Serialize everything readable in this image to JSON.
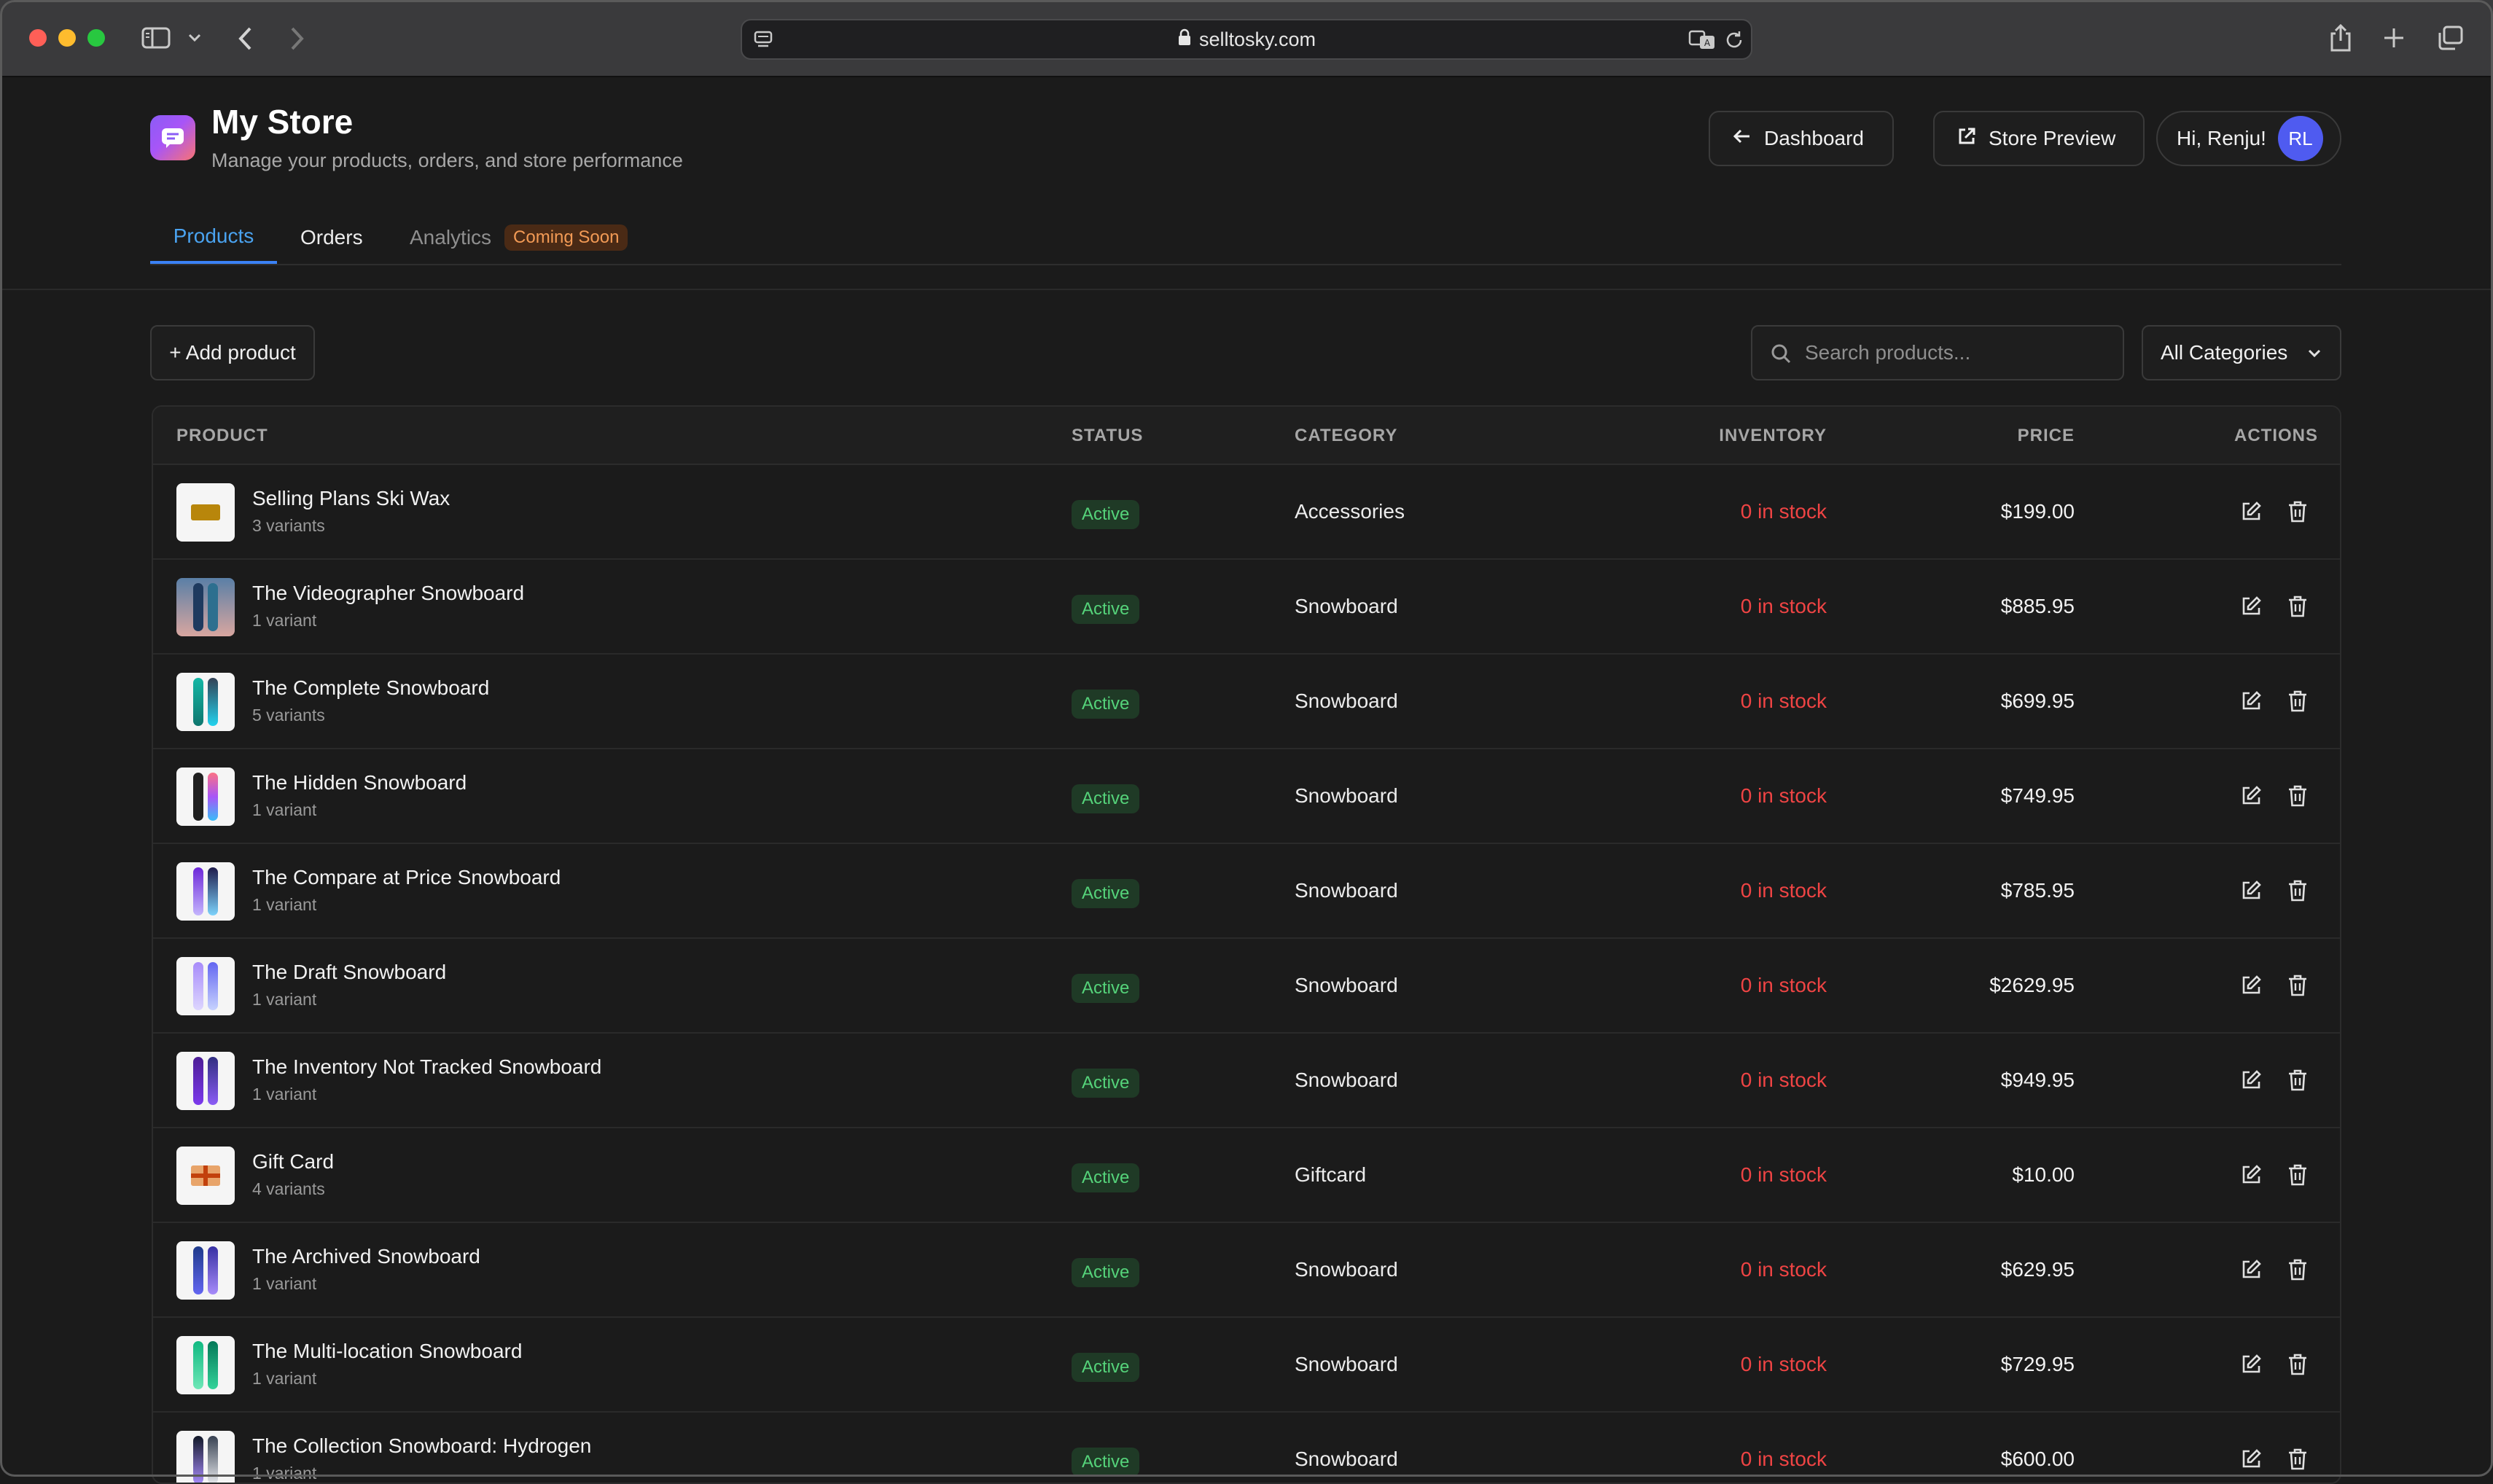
{
  "browser": {
    "url": "selltosky.com"
  },
  "header": {
    "title": "My Store",
    "subtitle": "Manage your products, orders, and store performance",
    "dashboard_label": "Dashboard",
    "preview_label": "Store Preview",
    "greeting": "Hi, Renju!",
    "avatar_initials": "RL"
  },
  "tabs": {
    "products": "Products",
    "orders": "Orders",
    "analytics": "Analytics",
    "analytics_badge": "Coming Soon"
  },
  "toolbar": {
    "add_label": "+ Add product",
    "search_placeholder": "Search products...",
    "category_selected": "All Categories"
  },
  "table": {
    "headers": {
      "product": "PRODUCT",
      "status": "STATUS",
      "category": "CATEGORY",
      "inventory": "INVENTORY",
      "price": "PRICE",
      "actions": "ACTIONS"
    },
    "rows": [
      {
        "name": "Selling Plans Ski Wax",
        "variants": "3 variants",
        "status": "Active",
        "category": "Accessories",
        "inventory": "0 in stock",
        "price": "$199.00"
      },
      {
        "name": "The Videographer Snowboard",
        "variants": "1 variant",
        "status": "Active",
        "category": "Snowboard",
        "inventory": "0 in stock",
        "price": "$885.95"
      },
      {
        "name": "The Complete Snowboard",
        "variants": "5 variants",
        "status": "Active",
        "category": "Snowboard",
        "inventory": "0 in stock",
        "price": "$699.95"
      },
      {
        "name": "The Hidden Snowboard",
        "variants": "1 variant",
        "status": "Active",
        "category": "Snowboard",
        "inventory": "0 in stock",
        "price": "$749.95"
      },
      {
        "name": "The Compare at Price Snowboard",
        "variants": "1 variant",
        "status": "Active",
        "category": "Snowboard",
        "inventory": "0 in stock",
        "price": "$785.95"
      },
      {
        "name": "The Draft Snowboard",
        "variants": "1 variant",
        "status": "Active",
        "category": "Snowboard",
        "inventory": "0 in stock",
        "price": "$2629.95"
      },
      {
        "name": "The Inventory Not Tracked Snowboard",
        "variants": "1 variant",
        "status": "Active",
        "category": "Snowboard",
        "inventory": "0 in stock",
        "price": "$949.95"
      },
      {
        "name": "Gift Card",
        "variants": "4 variants",
        "status": "Active",
        "category": "Giftcard",
        "inventory": "0 in stock",
        "price": "$10.00"
      },
      {
        "name": "The Archived Snowboard",
        "variants": "1 variant",
        "status": "Active",
        "category": "Snowboard",
        "inventory": "0 in stock",
        "price": "$629.95"
      },
      {
        "name": "The Multi-location Snowboard",
        "variants": "1 variant",
        "status": "Active",
        "category": "Snowboard",
        "inventory": "0 in stock",
        "price": "$729.95"
      },
      {
        "name": "The Collection Snowboard: Hydrogen",
        "variants": "1 variant",
        "status": "Active",
        "category": "Snowboard",
        "inventory": "0 in stock",
        "price": "$600.00"
      }
    ]
  },
  "colors": {
    "accent_tab": "#3b82f6",
    "status_active": "#55d37a",
    "inventory_out": "#ef4444",
    "badge_soon": "#f29a55",
    "avatar_bg": "#4f5bf0"
  },
  "icons": {
    "lock": "lock-icon",
    "back": "arrow-left-icon",
    "external": "external-link-icon",
    "search": "search-icon",
    "chevron": "chevron-down-icon",
    "edit": "edit-icon",
    "delete": "trash-icon"
  }
}
